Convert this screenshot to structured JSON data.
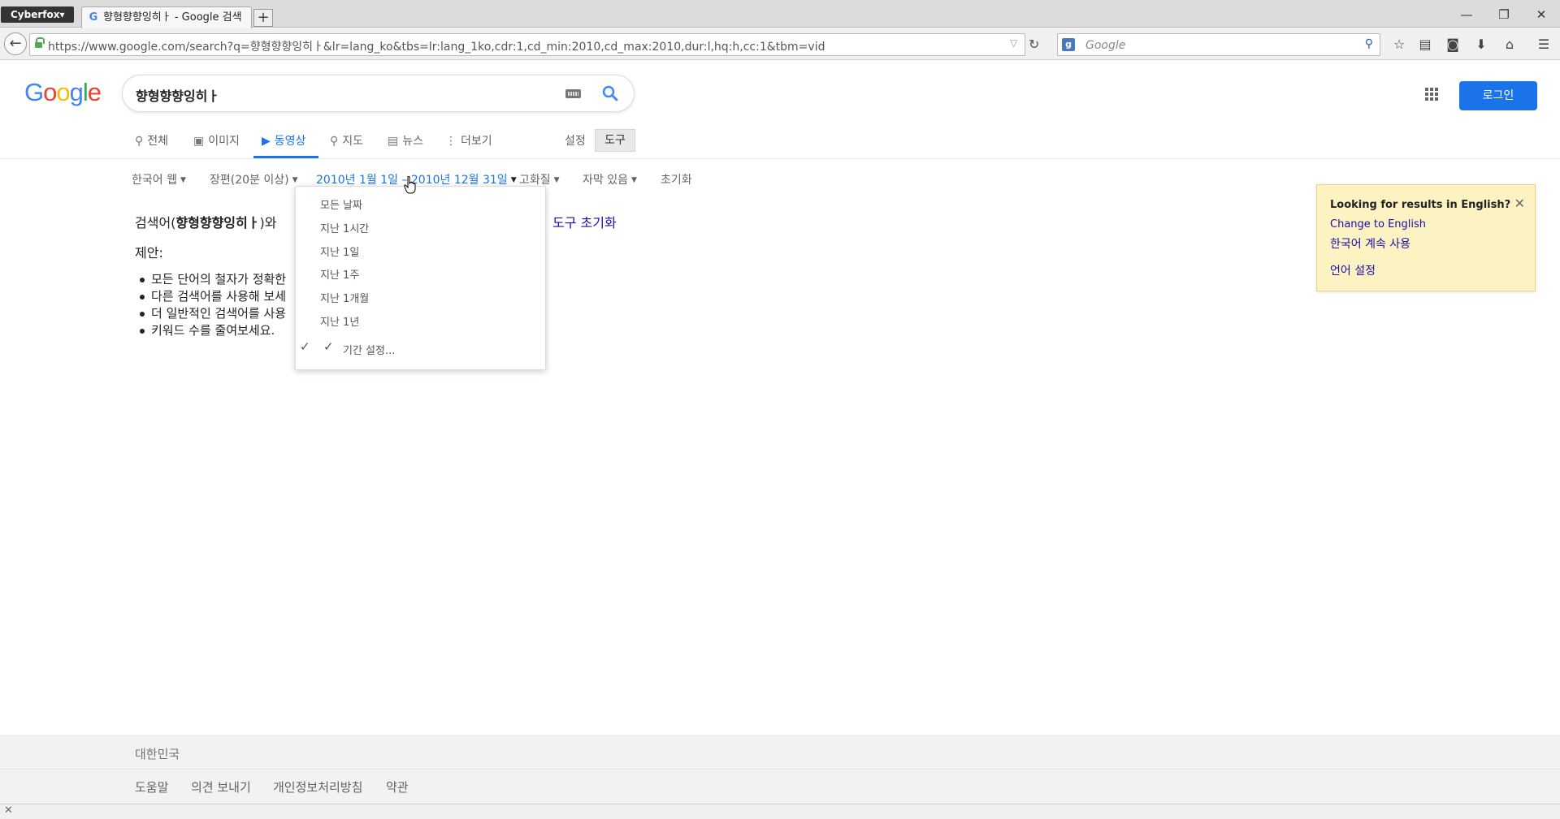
{
  "browser": {
    "app_menu": "Cyberfox▾",
    "tab_title": "향형향향잉히ㅏ - Google 검색",
    "new_tab": "+",
    "url": "https://www.google.com/search?q=향형향향잉히ㅏ&lr=lang_ko&tbs=lr:lang_1ko,cdr:1,cd_min:2010,cd_max:2010,dur:l,hq:h,cc:1&tbm=vid",
    "search_placeholder": "Google",
    "window_controls": [
      "—",
      "❐",
      "✕"
    ]
  },
  "google": {
    "logo_letters": [
      "G",
      "o",
      "o",
      "g",
      "l",
      "e"
    ],
    "query": "향형향향잉히ㅏ",
    "login": "로그인",
    "tabs": [
      {
        "label": "전체",
        "icon": "search-icon"
      },
      {
        "label": "이미지",
        "icon": "image-icon"
      },
      {
        "label": "동영상",
        "icon": "video-icon"
      },
      {
        "label": "지도",
        "icon": "map-pin-icon"
      },
      {
        "label": "뉴스",
        "icon": "news-icon"
      },
      {
        "label": "더보기",
        "icon": "more-vert-icon"
      }
    ],
    "active_tab": "동영상",
    "settings": "설정",
    "tools": "도구"
  },
  "filters": {
    "language": "한국어 웹",
    "duration": "장편(20분 이상)",
    "date_range": "2010년 1월 1일 – 2010년 12월 31일",
    "quality": "고화질",
    "captions": "자막 있음",
    "reset": "초기화"
  },
  "results": {
    "no_results_prefix": "검색어(",
    "query": "향형향향잉히ㅏ",
    "no_results_suffix": ")와",
    "reset_tools": "도구 초기화",
    "suggestion_heading": "제안:",
    "suggestions": [
      "모든 단어의 철자가 정확한",
      "다른 검색어를 사용해 보세",
      "더 일반적인 검색어를 사용",
      "키워드 수를 줄여보세요."
    ]
  },
  "date_dropdown": {
    "items": [
      "모든 날짜",
      "지난 1시간",
      "지난 1일",
      "지난 1주",
      "지난 1개월",
      "지난 1년"
    ],
    "custom": "기간 설정...",
    "check": "✓"
  },
  "english_box": {
    "title": "Looking for results in English?",
    "change": "Change to English",
    "continue_korean": "한국어 계속 사용",
    "language_settings": "언어 설정",
    "close": "✕"
  },
  "footer": {
    "country": "대한민국",
    "links": [
      "도움말",
      "의견 보내기",
      "개인정보처리방침",
      "약관"
    ]
  },
  "statusbar": {
    "close": "✕"
  }
}
